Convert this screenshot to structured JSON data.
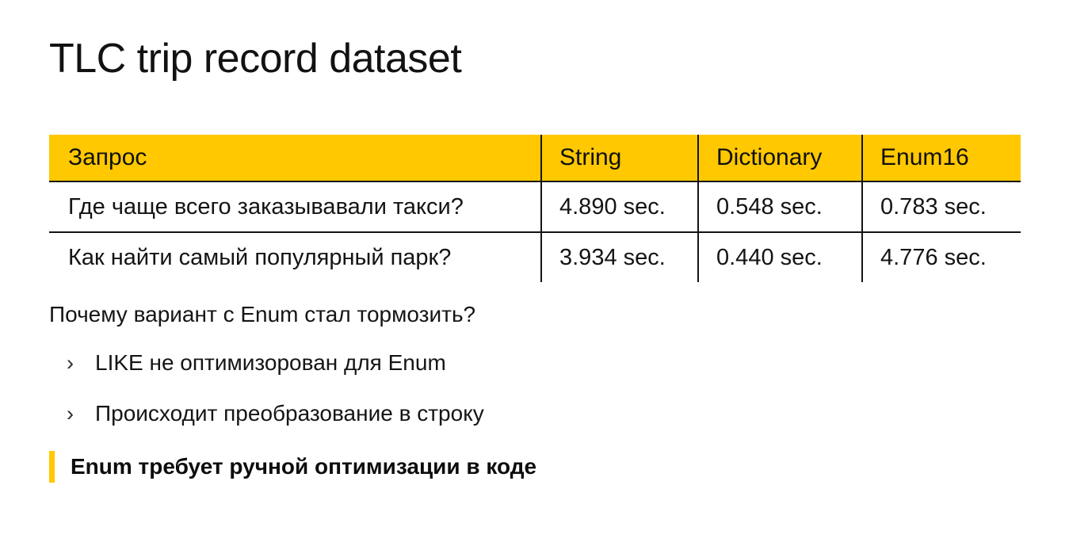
{
  "slide": {
    "title": "TLC trip record dataset",
    "accent_color": "#ffc800",
    "text_color": "#141414",
    "background_color": "#ffffff"
  },
  "table": {
    "headers": [
      "Запрос",
      "String",
      "Dictionary",
      "Enum16"
    ],
    "rows": [
      {
        "query": "Где чаще всего заказывавали такси?",
        "string": "4.890 sec.",
        "dictionary": "0.548 sec.",
        "enum16": "0.783 sec."
      },
      {
        "query": "Как найти самый популярный парк?",
        "string": "3.934 sec.",
        "dictionary": "0.440 sec.",
        "enum16": "4.776 sec."
      }
    ]
  },
  "content": {
    "lead": "Почему вариант с Enum стал тормозить?",
    "bullet_marker": "›",
    "bullets": [
      "LIKE не оптимизорован для Enum",
      "Происходит преобразование в строку"
    ],
    "conclusion": "Enum требует ручной оптимизации в коде"
  }
}
